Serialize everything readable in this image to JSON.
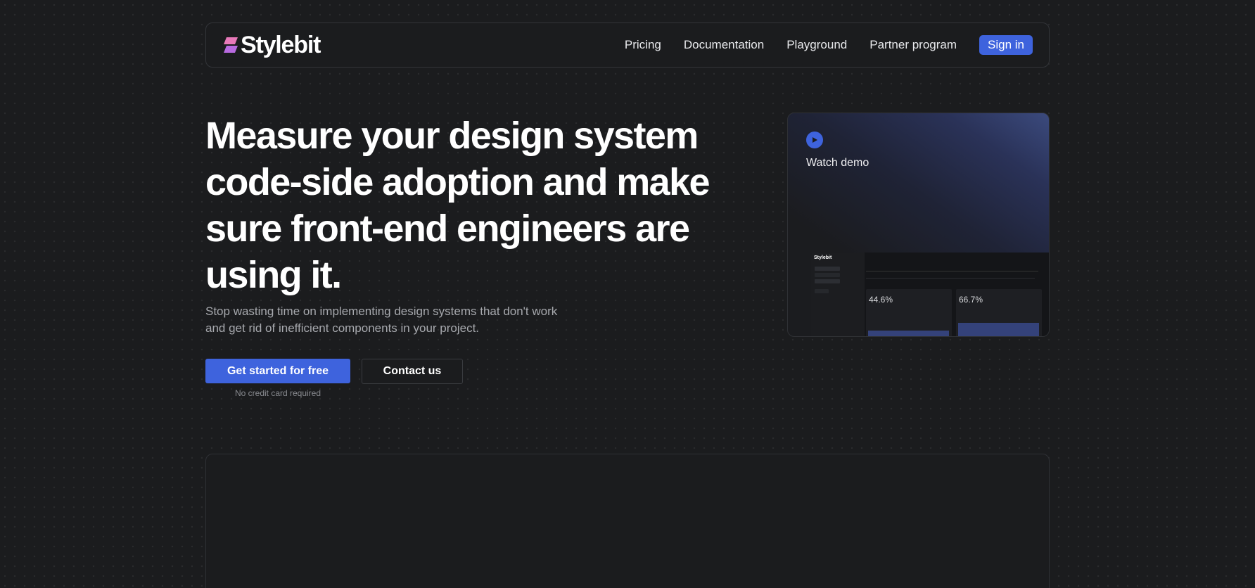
{
  "brand": {
    "name": "Stylebit",
    "accent": "#3e63dd",
    "logo_colors": [
      "#e879b9",
      "#b86ae0"
    ]
  },
  "nav": {
    "links": [
      "Pricing",
      "Documentation",
      "Playground",
      "Partner program"
    ],
    "signin_label": "Sign in"
  },
  "hero": {
    "title": "Measure your design system code-side adoption and make sure front-end engineers are using it.",
    "subtitle": "Stop wasting time on implementing design systems that don't work and get rid of inefficient components in your project.",
    "primary_cta": "Get started for free",
    "secondary_cta": "Contact us",
    "primary_note": "No credit card required"
  },
  "demo": {
    "play_icon": "play-icon",
    "label": "Watch demo",
    "preview": {
      "brand": "Stylebit",
      "stats": [
        {
          "value": "44.6%",
          "level": 0.15
        },
        {
          "value": "66.7%",
          "level": 0.3
        }
      ]
    }
  }
}
